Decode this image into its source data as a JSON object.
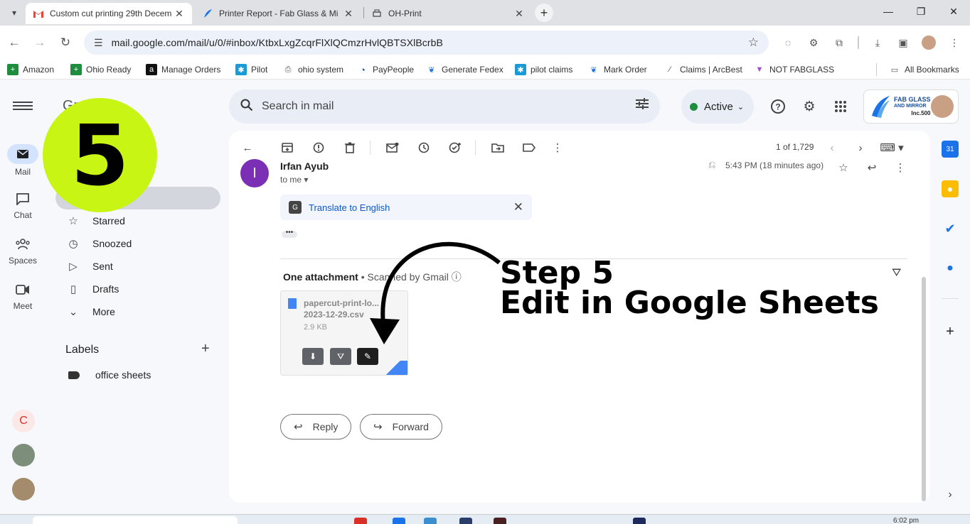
{
  "browser": {
    "tabs": [
      {
        "title": "Custom cut printing 29th Decem",
        "active": true
      },
      {
        "title": "Printer Report - Fab Glass & Mi",
        "active": false
      },
      {
        "title": "OH-Print",
        "active": false
      }
    ],
    "url": "mail.google.com/mail/u/0/#inbox/KtbxLxgZcqrFlXlQCmzrHvlQBTSXlBcrbB",
    "bookmarks": [
      "Amazon",
      "Ohio Ready",
      "Manage Orders",
      "Pilot",
      "ohio system",
      "PayPeople",
      "Generate Fedex",
      "pilot claims",
      "Mark Order",
      "Claims | ArcBest",
      "NOT FABGLASS"
    ],
    "all_bookmarks": "All Bookmarks"
  },
  "gmail": {
    "logo": "Gmail",
    "search_placeholder": "Search in mail",
    "status": "Active",
    "account_brand_line1": "FAB GLASS",
    "account_brand_line2": "AND MIRROR",
    "account_brand_line3": "Inc.500",
    "rail": [
      {
        "label": "Mail"
      },
      {
        "label": "Chat"
      },
      {
        "label": "Spaces"
      },
      {
        "label": "Meet"
      }
    ],
    "nav": [
      "Starred",
      "Snoozed",
      "Sent",
      "Drafts",
      "More"
    ],
    "labels_heading": "Labels",
    "labels": [
      "office sheets"
    ],
    "rail_avatar_letter": "C",
    "pager": "1 of 1,729"
  },
  "email": {
    "sender_initial": "I",
    "sender": "Irfan Ayub",
    "to": "to me",
    "time": "5:43 PM (18 minutes ago)",
    "translate": "Translate to English",
    "attachment_heading": "One attachment",
    "scanned": "Scanned by Gmail",
    "attachment": {
      "name_line1": "papercut-print-lo...",
      "name_line2": "2023-12-29.csv",
      "size": "2.9 KB"
    },
    "reply": "Reply",
    "forward": "Forward"
  },
  "annotation": {
    "badge": "5",
    "line1": "Step 5",
    "line2": "Edit in Google Sheets"
  },
  "taskbar": {
    "clock": "6:02 pm"
  }
}
